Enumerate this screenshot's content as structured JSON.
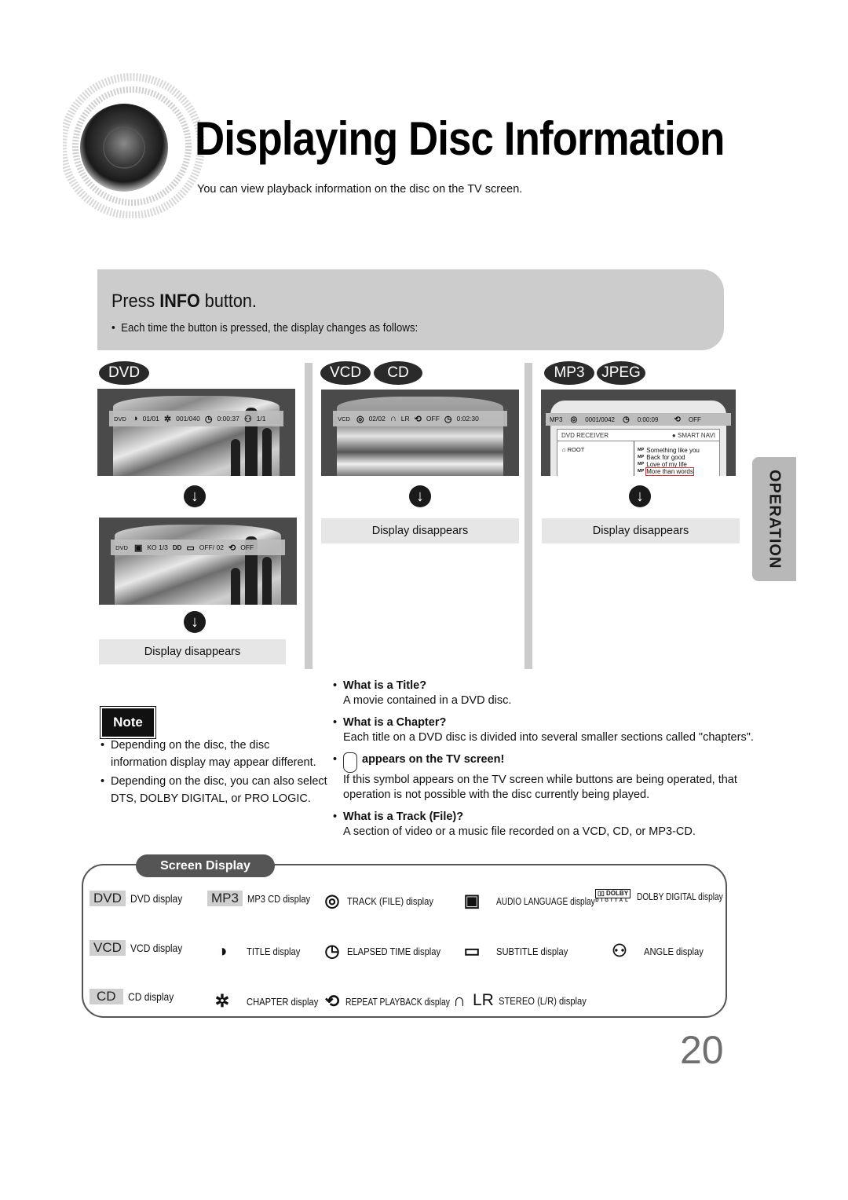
{
  "header": {
    "title": "Displaying Disc Information",
    "subtitle": "You can view playback information on the disc on the TV screen."
  },
  "instruction": {
    "heading_pre": "Press ",
    "heading_bold": "INFO",
    "heading_post": " button.",
    "bullet": "Each time the button is pressed, the display changes as follows:"
  },
  "columns": {
    "dvd": {
      "pills": [
        "DVD"
      ],
      "screen1": {
        "label": "DVD",
        "title": "01/01",
        "chapter": "001/040",
        "time": "0:00:37",
        "angle": "1/1"
      },
      "screen2": {
        "label": "DVD",
        "audio": "KO 1/3",
        "subtitle": "OFF/ 02",
        "repeat": "OFF"
      },
      "final": "Display disappears"
    },
    "vcd": {
      "pills": [
        "VCD",
        "CD"
      ],
      "screen1": {
        "label": "VCD",
        "track": "02/02",
        "stereo": "LR",
        "repeat": "OFF",
        "time": "0:02:30"
      },
      "final": "Display disappears"
    },
    "mp3": {
      "pills": [
        "MP3",
        "JPEG"
      ],
      "screen1": {
        "label": "MP3",
        "track": "0001/0042",
        "time": "0:00:09",
        "repeat": "OFF",
        "browser_title": "DVD RECEIVER",
        "browser_mode": "SMART NAVI",
        "folder": "ROOT",
        "tracks": [
          "Something like you",
          "Back for good",
          "Love of my life",
          "More than words"
        ],
        "selected_track": "More than words"
      },
      "final": "Display disappears"
    }
  },
  "side_tab": "OPERATION",
  "note": {
    "badge": "Note",
    "items": [
      "Depending on the disc, the disc information display may appear different.",
      "Depending on the disc, you can also select DTS, DOLBY DIGITAL, or PRO LOGIC."
    ]
  },
  "definitions": [
    {
      "q": "What is a Title?",
      "a": "A movie contained in a DVD disc."
    },
    {
      "q": "What is a Chapter?",
      "a": "Each title on a DVD disc is divided into several smaller sections called \"chapters\"."
    },
    {
      "q": "appears on the TV screen!",
      "a": "If this symbol appears on the TV screen while buttons are being operated, that operation is not possible with the disc currently being played.",
      "icon": "hand-icon"
    },
    {
      "q": "What is a Track (File)?",
      "a": "A section of video or a music file recorded on a VCD, CD, or MP3-CD."
    }
  ],
  "legend": {
    "title": "Screen Display",
    "items": [
      {
        "chip": "DVD",
        "text": "DVD display"
      },
      {
        "chip": "MP3",
        "text": "MP3 CD display"
      },
      {
        "icon": "track-icon",
        "text": "TRACK (FILE) display"
      },
      {
        "icon": "audio-language-icon",
        "text": "AUDIO LANGUAGE display"
      },
      {
        "icon": "dolby-digital-icon",
        "text": "DOLBY DIGITAL display",
        "logo_top": "DOLBY",
        "logo_bottom": "DIGITAL"
      },
      {
        "chip": "VCD",
        "text": "VCD display"
      },
      {
        "icon": "title-icon",
        "text": "TITLE display"
      },
      {
        "icon": "elapsed-time-icon",
        "text": "ELAPSED TIME display"
      },
      {
        "icon": "subtitle-icon",
        "text": "SUBTITLE display"
      },
      {
        "icon": "angle-icon",
        "text": "ANGLE display"
      },
      {
        "chip": "CD",
        "text": "CD display"
      },
      {
        "icon": "chapter-icon",
        "text": "CHAPTER display"
      },
      {
        "icon": "repeat-icon",
        "text": "REPEAT PLAYBACK display"
      },
      {
        "icon": "stereo-icon",
        "text": "STEREO (L/R) display",
        "stereo_label": "LR"
      }
    ]
  },
  "page_number": "20"
}
